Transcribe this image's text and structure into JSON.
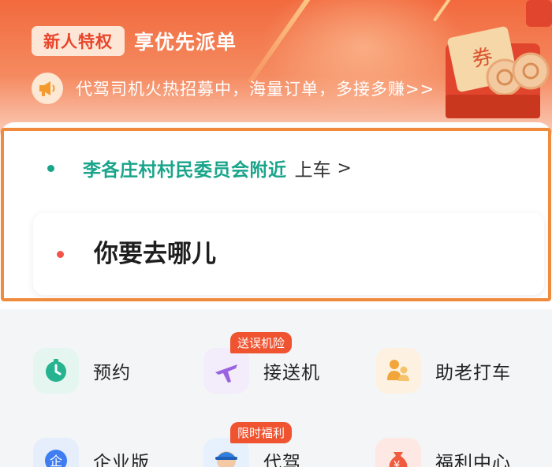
{
  "banner": {
    "tag": "新人特权",
    "title": "享优先派单",
    "notice": "代驾司机火热招募中，海量订单，多接多赚>>",
    "icons": {
      "speaker": "megaphone-icon",
      "gift": "coupon-gift-box-icon"
    },
    "colors": {
      "background": "#f26a3e",
      "tag_text": "#e9452a"
    }
  },
  "trip": {
    "pickup_place": "李各庄村村民委员会附近",
    "pickup_suffix": "上车",
    "pickup_chevron": ">",
    "destination_placeholder": "你要去哪儿",
    "colors": {
      "pickup_dot": "#1aa58b",
      "destination_dot": "#f2544a",
      "highlight": "#f08a3c"
    }
  },
  "services": [
    {
      "label": "预约",
      "icon": "clock-icon",
      "badge": ""
    },
    {
      "label": "接送机",
      "icon": "airplane-icon",
      "badge": "送误机险"
    },
    {
      "label": "助老打车",
      "icon": "elderly-person-icon",
      "badge": ""
    },
    {
      "label": "企业版",
      "icon": "enterprise-icon",
      "badge": ""
    },
    {
      "label": "代驾",
      "icon": "driver-avatar-icon",
      "badge": "限时福利"
    },
    {
      "label": "福利中心",
      "icon": "money-bag-icon",
      "badge": ""
    }
  ]
}
